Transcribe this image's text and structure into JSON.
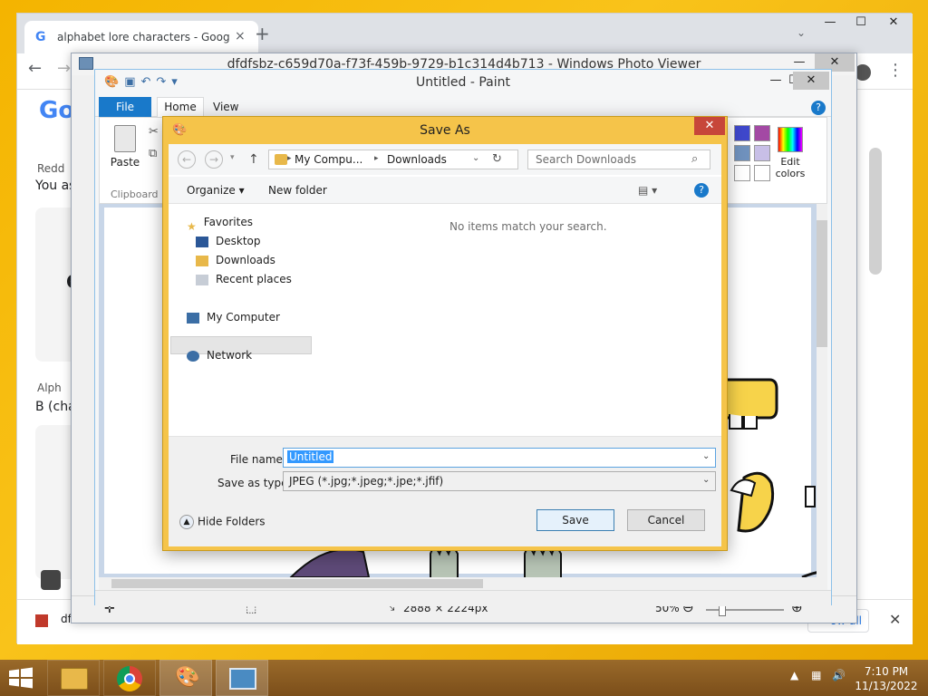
{
  "chrome": {
    "tab_title": "alphabet lore characters - Google Search",
    "tab_close": "×",
    "new_tab": "+",
    "tab_search": "⌄",
    "minimize": "—",
    "maximize": "☐",
    "close": "✕",
    "back": "←",
    "forward": "→",
    "menu": "⋮",
    "logo": "Go",
    "page_text": {
      "reddit_source": "Redd",
      "you_as": "You as",
      "alph_source": "Alph",
      "b_char": "B (cha",
      "q_letter": "C"
    },
    "bottom_file": "dfdfsb",
    "show_all": "ow all",
    "bottom_close": "✕"
  },
  "photo_viewer": {
    "title": "dfdfsbz-c659d70a-f73f-459b-9729-b1c314d4b713 - Windows Photo Viewer",
    "minimize": "—",
    "maximize": "☐",
    "close": "✕",
    "dimensions": "2888 × 2224px",
    "zoom": "50%",
    "zoom_out": "⊖",
    "zoom_in": "⊕"
  },
  "paint": {
    "title": "Untitled - Paint",
    "minimize": "—",
    "maximize": "☐",
    "close": "✕",
    "tabs": {
      "file": "File",
      "home": "Home",
      "view": "View"
    },
    "help": "?",
    "paste": "Paste",
    "clipboard": "Clipboard",
    "edit_colors": "Edit colors",
    "palette": [
      "#3f48cc",
      "#a349a4",
      "#7092be",
      "#c8bfe7",
      "#ffffff",
      "#ffffff"
    ]
  },
  "save_as": {
    "title": "Save As",
    "close": "✕",
    "address": {
      "part1": "My Compu...",
      "part2": "Downloads"
    },
    "search_placeholder": "Search Downloads",
    "organize": "Organize ▾",
    "new_folder": "New folder",
    "nav": {
      "favorites": "Favorites",
      "desktop": "Desktop",
      "downloads": "Downloads",
      "recent_places": "Recent places",
      "my_computer": "My Computer",
      "network": "Network"
    },
    "empty_message": "No items match your search.",
    "file_name_label": "File name:",
    "file_name_value": "Untitled",
    "save_type_label": "Save as type:",
    "save_type_value": "JPEG (*.jpg;*.jpeg;*.jpe;*.jfif)",
    "hide_folders": "Hide Folders",
    "save": "Save",
    "cancel": "Cancel"
  },
  "taskbar": {
    "time": "7:10 PM",
    "date": "11/13/2022"
  },
  "colors": {
    "desktop": "#f4b400",
    "dialog_frame": "#f5c44a",
    "paint_file_tab": "#1979ca",
    "selection": "#3399ff"
  }
}
